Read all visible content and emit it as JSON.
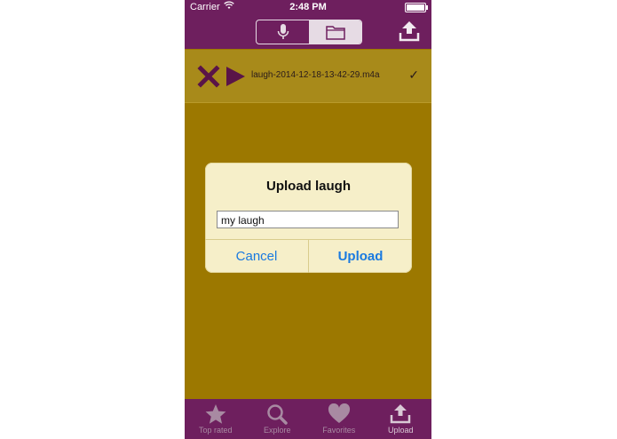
{
  "status_bar": {
    "carrier": "Carrier",
    "time": "2:48 PM"
  },
  "nav": {
    "segments": [
      {
        "icon": "microphone-icon",
        "selected": false
      },
      {
        "icon": "folder-icon",
        "selected": true
      }
    ],
    "upload_icon": "upload-icon"
  },
  "recording": {
    "filename": "laugh-2014-12-18-13-42-29.m4a",
    "check": "✓"
  },
  "dialog": {
    "title": "Upload laugh",
    "input_value": "my laugh",
    "cancel_label": "Cancel",
    "upload_label": "Upload"
  },
  "tabs": [
    {
      "label": "Top rated",
      "icon": "star-icon"
    },
    {
      "label": "Explore",
      "icon": "magnifier-icon"
    },
    {
      "label": "Favorites",
      "icon": "heart-icon"
    },
    {
      "label": "Upload",
      "icon": "upload-icon"
    }
  ],
  "colors": {
    "nav_bg": "#6e1f5e",
    "content_bg": "#9c7800",
    "dialog_bg": "#f6efc9",
    "button_text": "#1a7ae0",
    "tab_label": "#a88aa2"
  }
}
